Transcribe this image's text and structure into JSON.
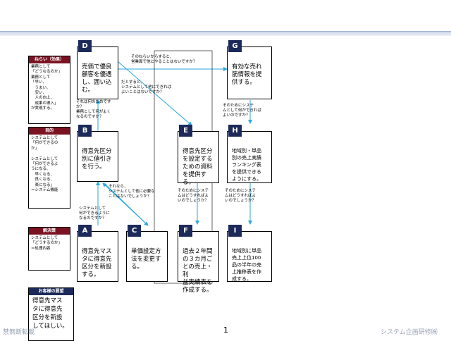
{
  "legend": {
    "aim": {
      "title": "ねらい（効果）",
      "body": "業務として\n「どうなるのか」\n業務として\n「早い、\n　うまい、\n　安い、\n　人の向上、\n　成果の導入」\nが実現する。"
    },
    "purpose": {
      "title": "目的",
      "body": "システムとして\n「何ができるの\nか」\n\nシステムとして\n「何ができるよ\nうになる、\n　早くなる、\n　良くなる、\n　楽になる」\n＝システム機能"
    },
    "solution": {
      "title": "解決策",
      "body": "システムとして\n「どうするのか」\n＝処理内容"
    }
  },
  "nodes": {
    "A": {
      "tag": "A",
      "text": "得意先マス\nタに得意先\n区分を新設\nする。"
    },
    "B": {
      "tag": "B",
      "text": "得意先区分\n別に値引き\nを行う。"
    },
    "C": {
      "tag": "C",
      "text": "単価設定方\n法を変更す\nる。"
    },
    "D": {
      "tag": "D",
      "text": "売価で優良\n顧客を優遇\nし、囲い込\nむ。"
    },
    "E": {
      "tag": "E",
      "text": "得意先区分\nを設定する\nための資料\nを提供す\nる。"
    },
    "F": {
      "tag": "F",
      "text": "過去２年間\nの３カ月ご\nとの売上・利\n益実績表を\n作成する。"
    },
    "G": {
      "tag": "G",
      "text": "有効な売れ\n筋情報を提\n供する。"
    },
    "H": {
      "tag": "H",
      "text": "地域別・単品\n別の売上実績\nランキング表\nを提供できる\nようにする。"
    },
    "I": {
      "tag": "I",
      "text": "地域別に単品\n売上上位100\n品の半年の売\n上推移表を作\n成する。"
    }
  },
  "notes": {
    "d_to_g": "そのねらいからすると、\n営業面で他にやることはないですか？",
    "d_to_e": "だとすると、\nシステムとして他にできれば\nよいことはないですか？",
    "b_to_d": "それは何のためです\nか？\n業務として何がよく\nなるのですか？",
    "a_to_b": "システムとして\n何ができるように\nなるのですか？",
    "b_to_c": "それなら、\nシステムとして他に必要な\nことはないでしょうか？",
    "e_to_f": "そのためにシステ\nムはどうすればよ\nいのでしょうか？",
    "g_to_h": "そのためにシステ\nムとして何ができれば\nよいのですか？",
    "h_to_i": "そのためにシステ\nムはどうすればよ\nいのでしょうか？"
  },
  "request": {
    "title": "お客様の要望",
    "body": "得意先マス\nタに得意先\n区分を新設\nしてほしい。"
  },
  "footer": {
    "left": "禁無断転載",
    "page": "1",
    "right": "システム企画研修㈱"
  },
  "colors": {
    "arrow": "#2aa7e0",
    "tag": "#1c2a5a",
    "legend_head": "#7a1222"
  }
}
